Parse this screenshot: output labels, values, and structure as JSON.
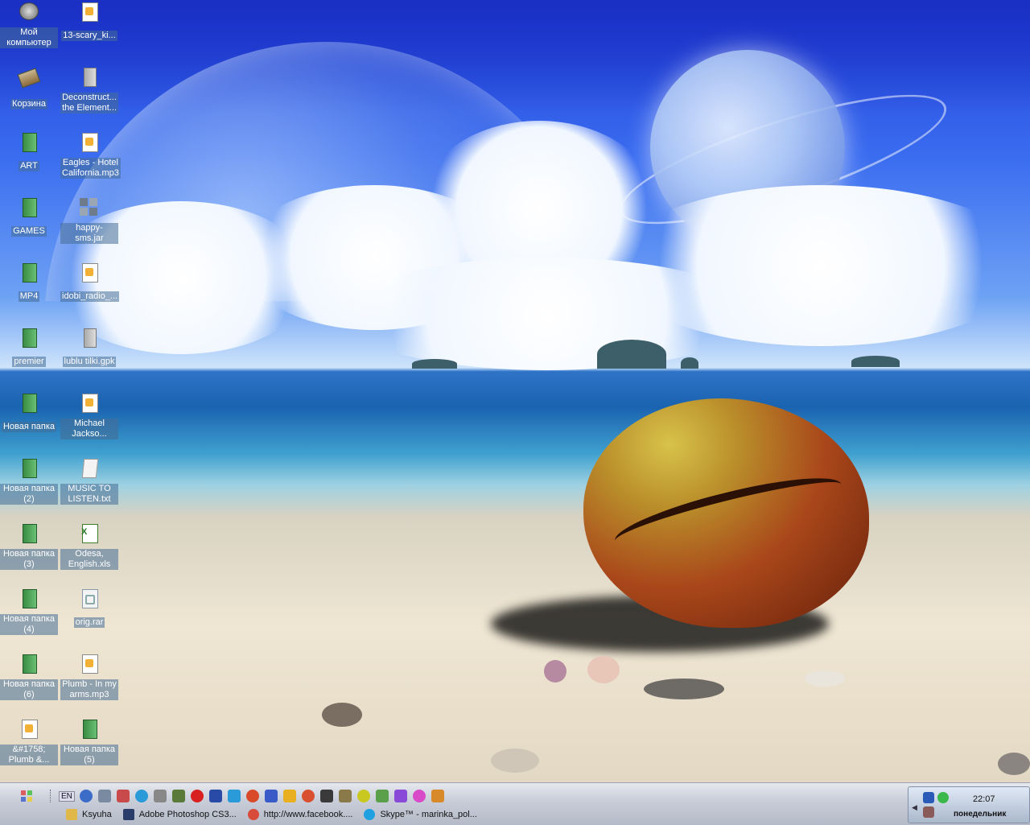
{
  "desktop_icons": {
    "col1": [
      {
        "label": "Мой компьютер",
        "icon": "computer-icon"
      },
      {
        "label": "Корзина",
        "icon": "recycle-bin-icon"
      },
      {
        "label": "ART",
        "icon": "folder-icon"
      },
      {
        "label": "GAMES",
        "icon": "folder-icon"
      },
      {
        "label": "MP4",
        "icon": "folder-icon"
      },
      {
        "label": "premier",
        "icon": "folder-icon"
      },
      {
        "label": "Новая папка",
        "icon": "folder-icon"
      },
      {
        "label": "Новая папка (2)",
        "icon": "folder-icon"
      },
      {
        "label": "Новая папка (3)",
        "icon": "folder-icon"
      },
      {
        "label": "Новая папка (4)",
        "icon": "folder-icon"
      },
      {
        "label": "Новая папка (6)",
        "icon": "folder-icon"
      },
      {
        "label": "&#1758; Plumb &...",
        "icon": "audio-file-icon"
      }
    ],
    "col2": [
      {
        "label": "13-scary_ki...",
        "icon": "audio-file-icon"
      },
      {
        "label": "Deconstruct... the Element...",
        "icon": "document-icon"
      },
      {
        "label": "Eagles - Hotel California.mp3",
        "icon": "audio-file-icon"
      },
      {
        "label": "happy-sms.jar",
        "icon": "jar-file-icon"
      },
      {
        "label": "idobi_radio_...",
        "icon": "audio-file-icon"
      },
      {
        "label": "lublu tilki.gpk",
        "icon": "document-icon"
      },
      {
        "label": "Michael Jackso...",
        "icon": "audio-file-icon"
      },
      {
        "label": "MUSIC TO LISTEN.txt",
        "icon": "text-file-icon"
      },
      {
        "label": "Odesa, English.xls",
        "icon": "excel-file-icon"
      },
      {
        "label": "orig.rar",
        "icon": "archive-file-icon"
      },
      {
        "label": "Plumb - In my arms.mp3",
        "icon": "audio-file-icon"
      },
      {
        "label": "Новая папка (5)",
        "icon": "folder-icon"
      }
    ]
  },
  "taskbar": {
    "language": "EN",
    "tasks": [
      {
        "label": "Ksyuha",
        "color": "#e0b84a"
      },
      {
        "label": "Adobe Photoshop CS3...",
        "color": "#2a3c6a"
      },
      {
        "label": "http://www.facebook....",
        "color": "#d84b3a"
      },
      {
        "label": "Skype™ - marinka_pol...",
        "color": "#1fa0e0"
      }
    ],
    "quicklaunch_colors": [
      "#3a6cc8",
      "#7a8aa0",
      "#c84a4a",
      "#2a9ad8",
      "#888888",
      "#5a7a3a",
      "#d82020",
      "#2a4aa8",
      "#2a9ad8",
      "#d84a2a",
      "#3a5ac8",
      "#e8b020",
      "#d85030",
      "#3a3a3a",
      "#8a7a4a",
      "#c8c820",
      "#5aa04a",
      "#8a4ad8",
      "#d84ac8",
      "#d88a2a"
    ],
    "clock": "22:07",
    "day": "понедельник"
  }
}
